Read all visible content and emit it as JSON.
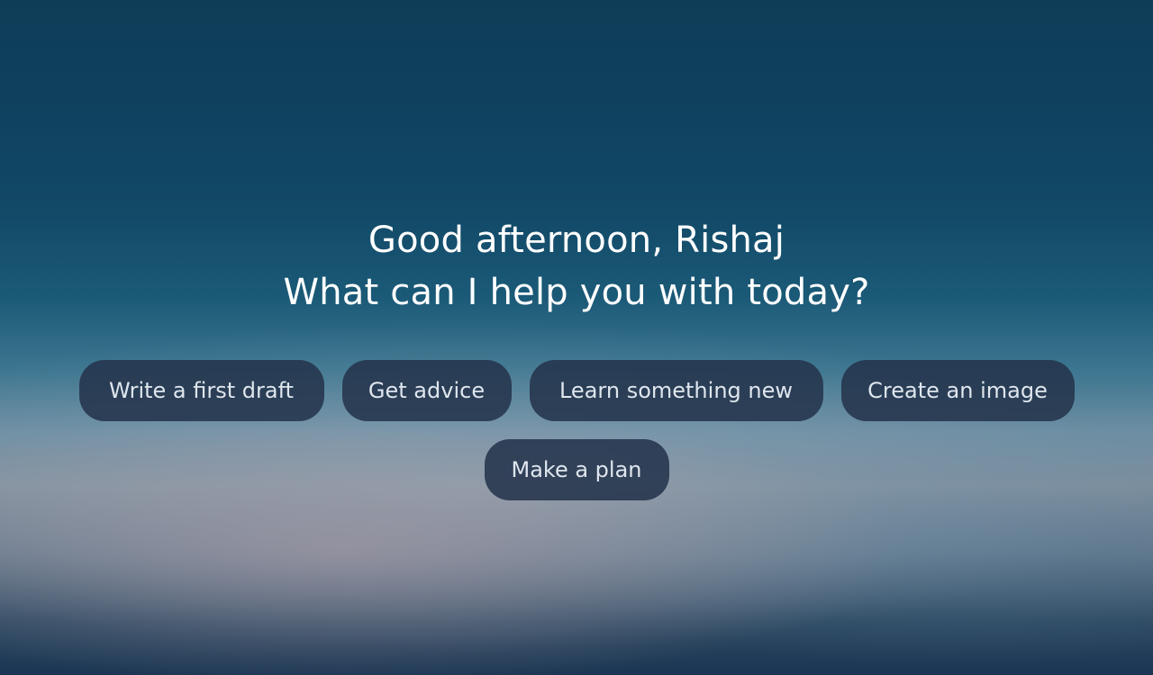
{
  "hero": {
    "greeting": "Good afternoon, Rishaj",
    "question": "What can I help you with today?"
  },
  "suggestions": [
    "Write a first draft",
    "Get advice",
    "Learn something new",
    "Create an image",
    "Make a plan"
  ],
  "colors": {
    "background_top": "#0e3d57",
    "background_haze": "#7f909e",
    "chip_background": "#24344c",
    "chip_text": "#dfe6ee",
    "heading_text": "#ffffff"
  }
}
